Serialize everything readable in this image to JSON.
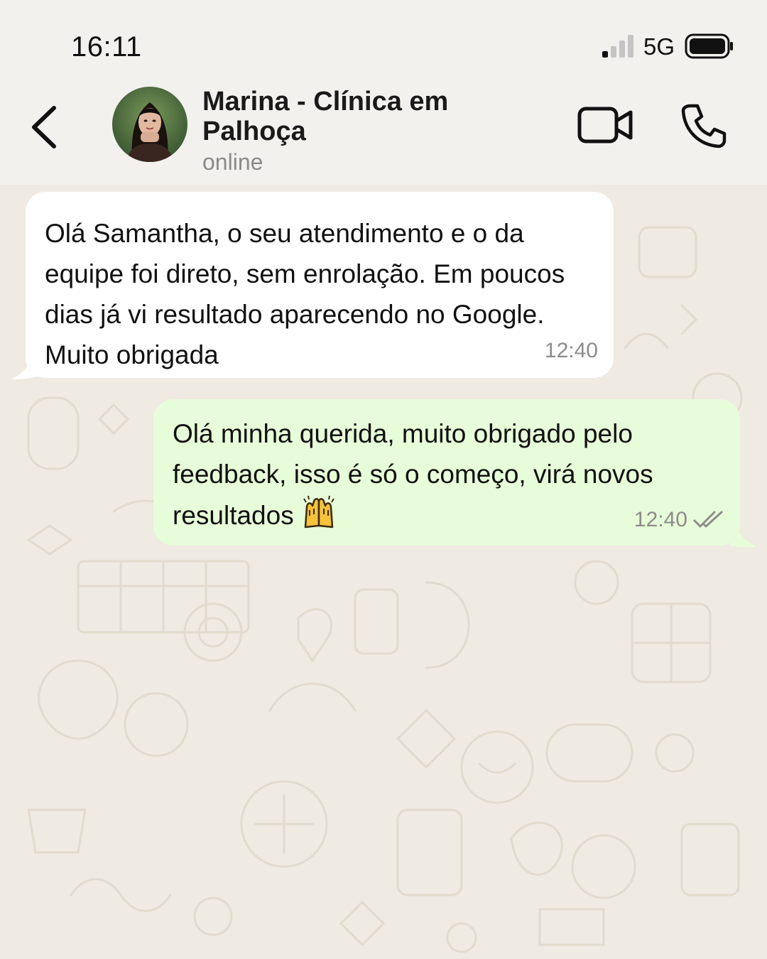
{
  "status_bar": {
    "time": "16:11",
    "network": "5G"
  },
  "header": {
    "contact_name": "Marina - Clínica em Palhoça",
    "contact_status": "online",
    "icons": [
      "back-icon",
      "avatar",
      "video-icon",
      "phone-icon"
    ]
  },
  "messages": [
    {
      "direction": "incoming",
      "text": "Olá Samantha, o seu atendimento e o da equipe foi direto, sem enrolação. Em poucos dias já vi resultado aparecendo no Google. Muito obrigada",
      "time": "12:40"
    },
    {
      "direction": "outgoing",
      "text": "Olá minha querida, muito obrigado pelo feedback, isso é só o começo, virá novos resultados",
      "emoji": "raising-hands",
      "time": "12:40",
      "read_status": "read-double-check"
    }
  ],
  "colors": {
    "incoming_bubble": "#ffffff",
    "outgoing_bubble": "#e7fcd8",
    "chat_background": "#efeae2",
    "header_background": "#f2f1ee"
  }
}
